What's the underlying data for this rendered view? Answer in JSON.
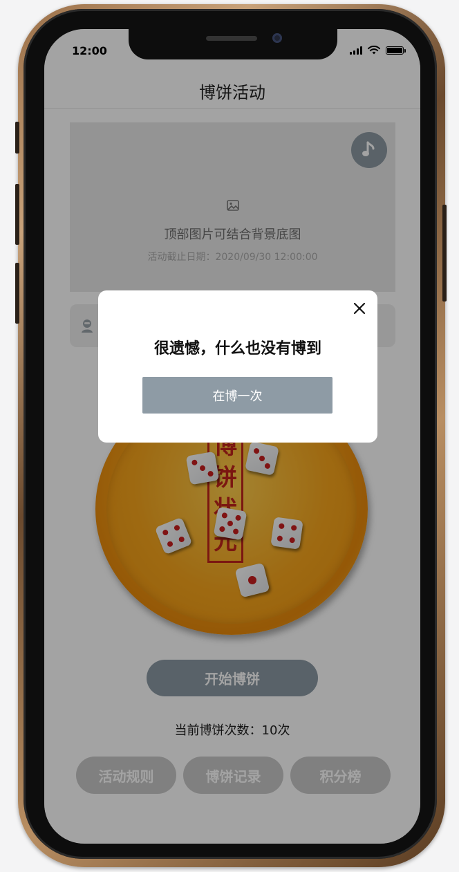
{
  "status_bar": {
    "time": "12:00"
  },
  "nav": {
    "title": "博饼活动"
  },
  "banner": {
    "title": "顶部图片可结合背景底图",
    "deadline": "活动截止日期：2020/09/30 12:00:00",
    "music_icon": "music-note-icon",
    "image_icon": "image-placeholder-icon"
  },
  "bowl": {
    "stamp_chars": [
      "博",
      "饼",
      "状",
      "元"
    ]
  },
  "start_button": {
    "label": "开始博饼"
  },
  "play_count": {
    "text": "当前博饼次数：10次"
  },
  "bottom_buttons": [
    {
      "label": "活动规则"
    },
    {
      "label": "博饼记录"
    },
    {
      "label": "积分榜"
    }
  ],
  "modal": {
    "title": "很遗憾，什么也没有博到",
    "retry_label": "在博一次",
    "close_icon": "close-icon"
  },
  "colors": {
    "accent": "#8e9ba5",
    "bowl": "#f6a21a",
    "stamp_red": "#c0241c"
  }
}
